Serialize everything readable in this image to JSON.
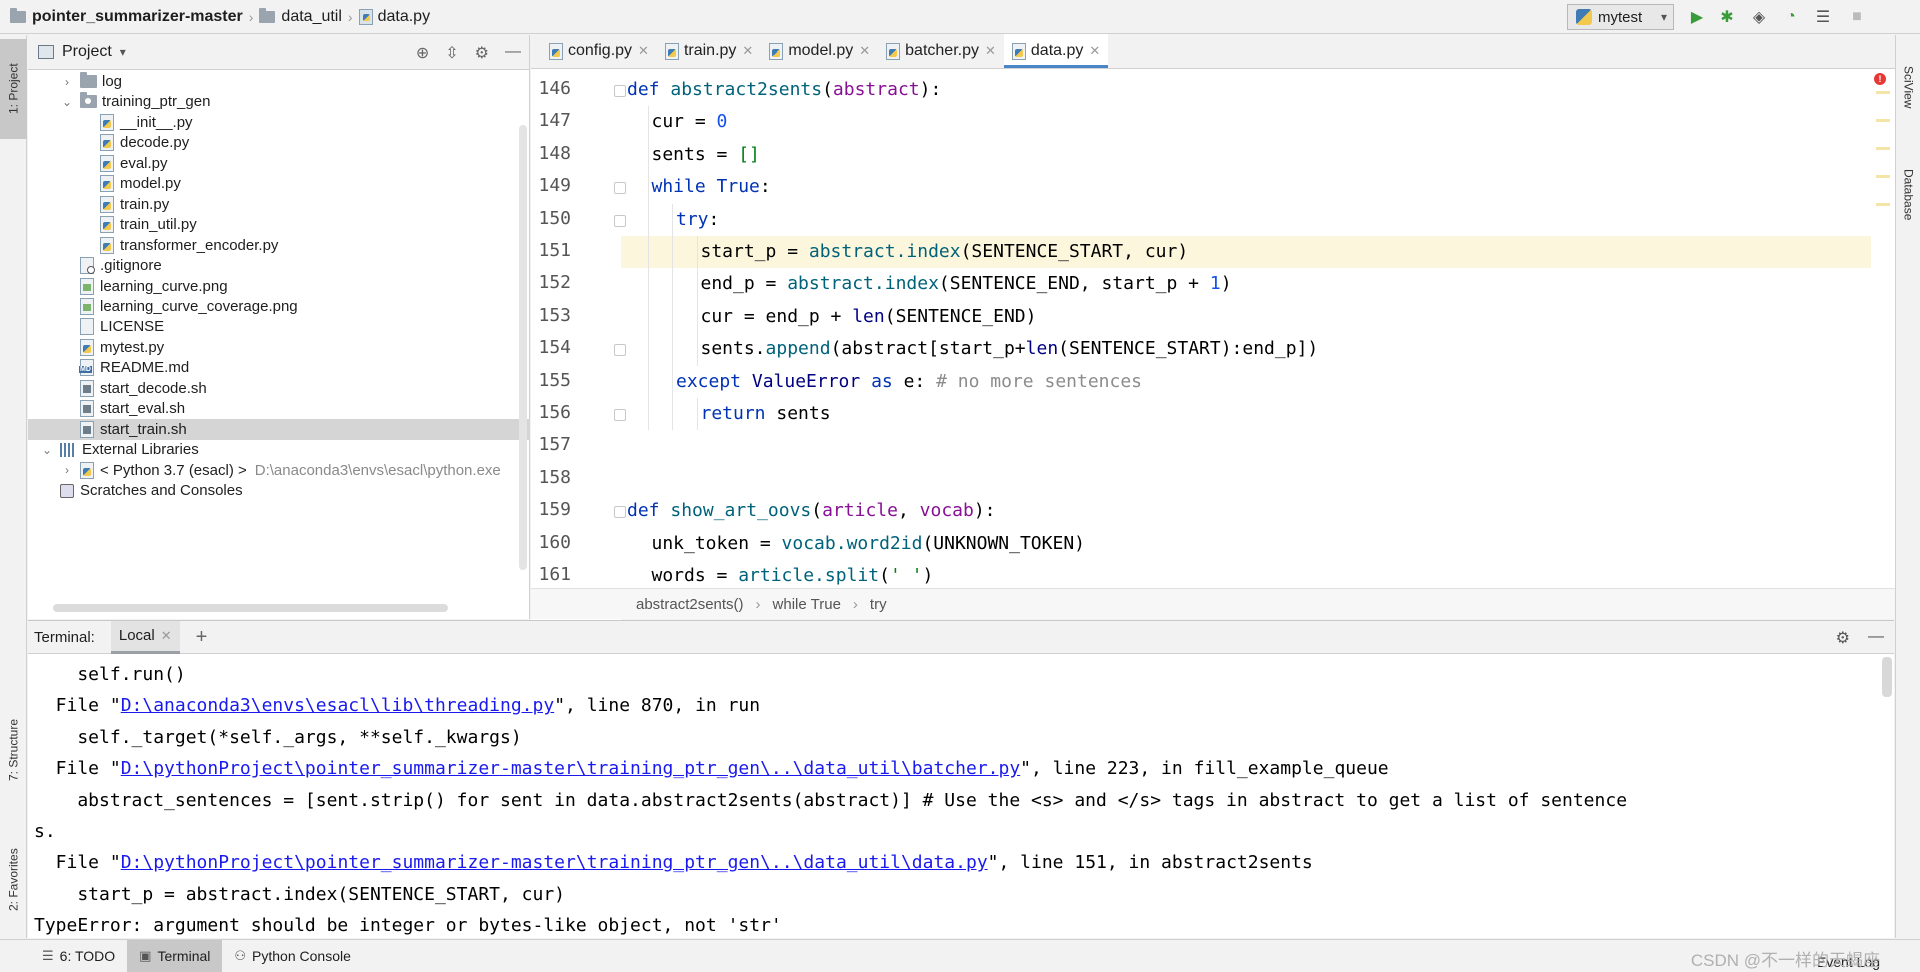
{
  "navbar": {
    "breadcrumbs": [
      "pointer_summarizer-master",
      "data_util",
      "data.py"
    ],
    "run_config": "mytest"
  },
  "left_strip": {
    "project_tab": "1: Project",
    "structure_tab": "7: Structure",
    "favorites_tab": "2: Favorites"
  },
  "right_strip": {
    "sciview_tab": "SciView",
    "database_tab": "Database"
  },
  "project": {
    "title": "Project",
    "tree": [
      {
        "label": "log",
        "kind": "dir",
        "depth": 1,
        "arrow": "›"
      },
      {
        "label": "training_ptr_gen",
        "kind": "pkg",
        "depth": 1,
        "arrow": "⌄"
      },
      {
        "label": "__init__.py",
        "kind": "py",
        "depth": 2
      },
      {
        "label": "decode.py",
        "kind": "py",
        "depth": 2
      },
      {
        "label": "eval.py",
        "kind": "py",
        "depth": 2
      },
      {
        "label": "model.py",
        "kind": "py",
        "depth": 2
      },
      {
        "label": "train.py",
        "kind": "py",
        "depth": 2
      },
      {
        "label": "train_util.py",
        "kind": "py",
        "depth": 2
      },
      {
        "label": "transformer_encoder.py",
        "kind": "py",
        "depth": 2
      },
      {
        "label": ".gitignore",
        "kind": "git",
        "depth": 1
      },
      {
        "label": "learning_curve.png",
        "kind": "img",
        "depth": 1
      },
      {
        "label": "learning_curve_coverage.png",
        "kind": "img",
        "depth": 1
      },
      {
        "label": "LICENSE",
        "kind": "txt",
        "depth": 1
      },
      {
        "label": "mytest.py",
        "kind": "py",
        "depth": 1
      },
      {
        "label": "README.md",
        "kind": "md",
        "depth": 1
      },
      {
        "label": "start_decode.sh",
        "kind": "sh",
        "depth": 1
      },
      {
        "label": "start_eval.sh",
        "kind": "sh",
        "depth": 1
      },
      {
        "label": "start_train.sh",
        "kind": "sh",
        "depth": 1,
        "selected": true
      },
      {
        "label": "External Libraries",
        "kind": "lib",
        "depth": 0,
        "arrow": "⌄"
      },
      {
        "label": "< Python 3.7 (esacl) >",
        "kind": "pyenv",
        "depth": 1,
        "arrow": "›",
        "extra": "D:\\anaconda3\\envs\\esacl\\python.exe"
      },
      {
        "label": "Scratches and Consoles",
        "kind": "sc",
        "depth": 0
      }
    ]
  },
  "editor": {
    "tabs": [
      {
        "label": "config.py",
        "active": false
      },
      {
        "label": "train.py",
        "active": false
      },
      {
        "label": "model.py",
        "active": false
      },
      {
        "label": "batcher.py",
        "active": false
      },
      {
        "label": "data.py",
        "active": true
      }
    ],
    "lines": [
      {
        "num": "146",
        "indent": 0,
        "tokens": [
          [
            "kw",
            "def "
          ],
          [
            "fn",
            "abstract2sents"
          ],
          [
            "id",
            "("
          ],
          [
            "param",
            "abstract"
          ],
          [
            "id",
            "):"
          ]
        ]
      },
      {
        "num": "147",
        "indent": 1,
        "tokens": [
          [
            "id",
            "cur = "
          ],
          [
            "num",
            "0"
          ]
        ]
      },
      {
        "num": "148",
        "indent": 1,
        "tokens": [
          [
            "id",
            "sents = "
          ],
          [
            "str",
            "[]"
          ]
        ]
      },
      {
        "num": "149",
        "indent": 1,
        "tokens": [
          [
            "kw",
            "while True"
          ],
          [
            "id",
            ":"
          ]
        ]
      },
      {
        "num": "150",
        "indent": 2,
        "tokens": [
          [
            "kw",
            "try"
          ],
          [
            "id",
            ":"
          ]
        ]
      },
      {
        "num": "151",
        "indent": 3,
        "highlight": true,
        "tokens": [
          [
            "id",
            "start_p = "
          ],
          [
            "fn",
            "abstract.index"
          ],
          [
            "id",
            "(SENTENCE_START, cur)"
          ]
        ]
      },
      {
        "num": "152",
        "indent": 3,
        "tokens": [
          [
            "id",
            "end_p = "
          ],
          [
            "fn",
            "abstract.index"
          ],
          [
            "id",
            "(SENTENCE_END, start_p + "
          ],
          [
            "num",
            "1"
          ],
          [
            "id",
            ")"
          ]
        ]
      },
      {
        "num": "153",
        "indent": 3,
        "tokens": [
          [
            "id",
            "cur = end_p + "
          ],
          [
            "bi",
            "len"
          ],
          [
            "id",
            "(SENTENCE_END)"
          ]
        ]
      },
      {
        "num": "154",
        "indent": 3,
        "tokens": [
          [
            "id",
            "sents."
          ],
          [
            "fn",
            "append"
          ],
          [
            "id",
            "(abstract[start_p+"
          ],
          [
            "bi",
            "len"
          ],
          [
            "id",
            "(SENTENCE_START):end_p])"
          ]
        ]
      },
      {
        "num": "155",
        "indent": 2,
        "tokens": [
          [
            "kw",
            "except "
          ],
          [
            "bi",
            "ValueError"
          ],
          [
            "kw",
            " as "
          ],
          [
            "id",
            "e: "
          ],
          [
            "cm",
            "# no more sentences"
          ]
        ]
      },
      {
        "num": "156",
        "indent": 3,
        "tokens": [
          [
            "kw",
            "return "
          ],
          [
            "id",
            "sents"
          ]
        ]
      },
      {
        "num": "157",
        "indent": 0,
        "tokens": []
      },
      {
        "num": "158",
        "indent": 0,
        "tokens": []
      },
      {
        "num": "159",
        "indent": 0,
        "tokens": [
          [
            "kw",
            "def "
          ],
          [
            "fn",
            "show_art_oovs"
          ],
          [
            "id",
            "("
          ],
          [
            "param",
            "article"
          ],
          [
            "id",
            ", "
          ],
          [
            "param",
            "vocab"
          ],
          [
            "id",
            "):"
          ]
        ]
      },
      {
        "num": "160",
        "indent": 1,
        "tokens": [
          [
            "id",
            "unk_token = "
          ],
          [
            "fn",
            "vocab.word2id"
          ],
          [
            "id",
            "(UNKNOWN_TOKEN)"
          ]
        ]
      },
      {
        "num": "161",
        "indent": 1,
        "tokens": [
          [
            "id",
            "words = "
          ],
          [
            "fn",
            "article.split"
          ],
          [
            "id",
            "("
          ],
          [
            "str",
            "' '"
          ],
          [
            "id",
            ")"
          ]
        ]
      }
    ],
    "breadcrumb": [
      "abstract2sents()",
      "while True",
      "try"
    ]
  },
  "terminal": {
    "label": "Terminal:",
    "tab": "Local",
    "lines": [
      [
        [
          "t",
          "    self.run()"
        ]
      ],
      [
        [
          "t",
          "  File \""
        ],
        [
          "l",
          "D:\\anaconda3\\envs\\esacl\\lib\\threading.py"
        ],
        [
          "t",
          "\", line 870, in run"
        ]
      ],
      [
        [
          "t",
          "    self._target(*self._args, **self._kwargs)"
        ]
      ],
      [
        [
          "t",
          "  File \""
        ],
        [
          "l",
          "D:\\pythonProject\\pointer_summarizer-master\\training_ptr_gen\\..\\data_util\\batcher.py"
        ],
        [
          "t",
          "\", line 223, in fill_example_queue"
        ]
      ],
      [
        [
          "t",
          "    abstract_sentences = [sent.strip() for sent in data.abstract2sents(abstract)] # Use the <s> and </s> tags in abstract to get a list of sentence"
        ]
      ],
      [
        [
          "t",
          "s."
        ]
      ],
      [
        [
          "t",
          "  File \""
        ],
        [
          "l",
          "D:\\pythonProject\\pointer_summarizer-master\\training_ptr_gen\\..\\data_util\\data.py"
        ],
        [
          "t",
          "\", line 151, in abstract2sents"
        ]
      ],
      [
        [
          "t",
          "    start_p = abstract.index(SENTENCE_START, cur)"
        ]
      ],
      [
        [
          "t",
          "TypeError: argument should be integer or bytes-like object, not 'str'"
        ]
      ]
    ]
  },
  "statusbar": {
    "todo": "6: TODO",
    "terminal": "Terminal",
    "python_console": "Python Console",
    "watermark": "CSDN @不一样的天蝎座",
    "event_log": "Event Log"
  }
}
